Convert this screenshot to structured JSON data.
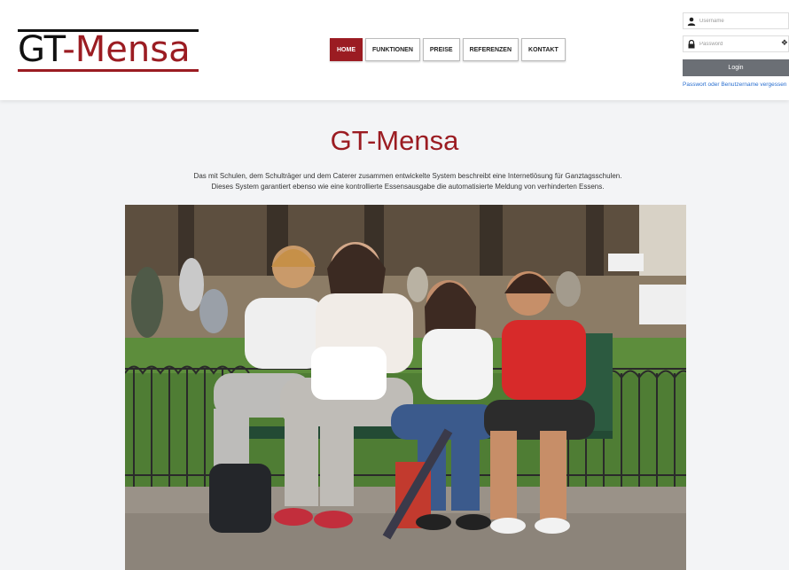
{
  "brand": {
    "prefix": "GT",
    "dash": "-",
    "name": "Mensa"
  },
  "nav": [
    {
      "label": "HOME",
      "active": true
    },
    {
      "label": "FUNKTIONEN",
      "active": false
    },
    {
      "label": "PREISE",
      "active": false
    },
    {
      "label": "REFERENZEN",
      "active": false
    },
    {
      "label": "KONTAKT",
      "active": false
    }
  ],
  "login": {
    "username_placeholder": "Username",
    "password_placeholder": "Password",
    "button_label": "Login",
    "forgot_link": "Passwort oder Benutzername vergessen",
    "user_icon": "user-icon",
    "lock_icon": "lock-icon",
    "eye_icon": "eye-icon"
  },
  "main": {
    "title": "GT-Mensa",
    "intro_line1": "Das mit Schulen, dem Schulträger und dem Caterer zusammen entwickelte System beschreibt eine Internetlösung für Ganztagsschulen.",
    "intro_line2": "Dieses System garantiert ebenso wie eine kontrollierte Essensausgabe die automatisierte Meldung von verhinderten Essens."
  },
  "colors": {
    "accent": "#9b1c22",
    "link": "#2a6fd0",
    "button": "#6b6f75"
  }
}
